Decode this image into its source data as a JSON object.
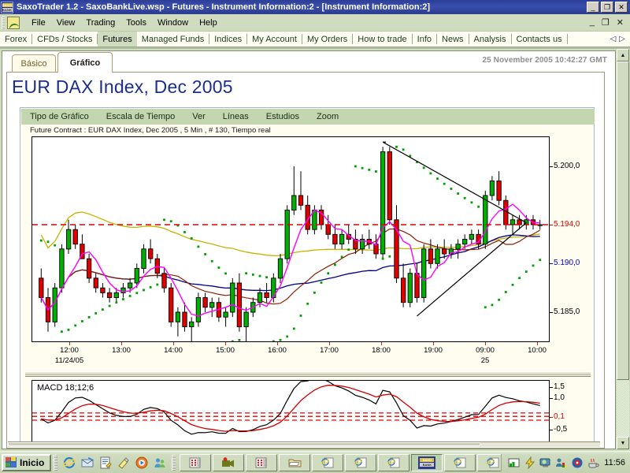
{
  "window": {
    "title": "SaxoTrader 1.2 - SaxoBankLive.wsp - Futures - Instrument Information:2 - [Instrument Information:2]",
    "logo_top": "SAXO",
    "logo_bottom": "BANK",
    "minimize": "_",
    "restore": "❐",
    "close": "✕"
  },
  "menubar": {
    "items": [
      "File",
      "View",
      "Trading",
      "Tools",
      "Window",
      "Help"
    ],
    "mdi_minimize": "_",
    "mdi_restore": "❐",
    "mdi_close": "✕"
  },
  "navstrip": {
    "items": [
      {
        "label": "Forex",
        "active": false
      },
      {
        "label": "CFDs / Stocks",
        "active": false
      },
      {
        "label": "Futures",
        "active": true
      },
      {
        "label": "Managed Funds",
        "active": false
      },
      {
        "label": "Indices",
        "active": false
      },
      {
        "label": "My Account",
        "active": false
      },
      {
        "label": "My Orders",
        "active": false
      },
      {
        "label": "How to trade",
        "active": false
      },
      {
        "label": "Info",
        "active": false
      },
      {
        "label": "News",
        "active": false
      },
      {
        "label": "Analysis",
        "active": false
      },
      {
        "label": "Contacts us",
        "active": false
      }
    ],
    "scroll_left": "◁",
    "scroll_right": "▷"
  },
  "document": {
    "tabs": [
      {
        "label": "Básico",
        "active": false
      },
      {
        "label": "Gráfico",
        "active": true
      }
    ],
    "timestamp": "25 November 2005 10:42:27 GMT",
    "title": "EUR DAX Index, Dec 2005"
  },
  "chart_toolbar": {
    "items": [
      "Tipo de Gráfico",
      "Escala de Tiempo",
      "Ver",
      "Líneas",
      "Estudios",
      "Zoom"
    ]
  },
  "chart_data": {
    "type": "line",
    "title": "Future Contract : EUR DAX Index, Dec 2005 , 5 Min , # 130, Tiempo real",
    "subtitle": "Future Contract : EUR DAX Index, Dec 2005 , 5 Min , # 130, Tiempo real",
    "instrument": "EUR DAX Index, Dec 2005",
    "interval": "5 Min",
    "bars": 130,
    "mode": "Tiempo real",
    "xlabel": "",
    "ylabel": "",
    "grid": false,
    "legend_position": "none",
    "ylim": [
      5182.0,
      5203.0
    ],
    "y_ticks": [
      {
        "value": 5200.0,
        "label": "5.200,0",
        "color": "#000000"
      },
      {
        "value": 5194.0,
        "label": "5.194,0",
        "color": "#e00000"
      },
      {
        "value": 5190.0,
        "label": "5.190,0",
        "color": "#0000cc"
      },
      {
        "value": 5185.0,
        "label": "5.185,0",
        "color": "#000000"
      }
    ],
    "x_ticks": [
      {
        "label": "12:00",
        "sub": "11/24/05"
      },
      {
        "label": "13:00",
        "sub": ""
      },
      {
        "label": "14:00",
        "sub": ""
      },
      {
        "label": "15:00",
        "sub": ""
      },
      {
        "label": "16:00",
        "sub": ""
      },
      {
        "label": "17:00",
        "sub": ""
      },
      {
        "label": "18:00",
        "sub": ""
      },
      {
        "label": "19:00",
        "sub": ""
      },
      {
        "label": "09:00",
        "sub": "25"
      },
      {
        "label": "10:00",
        "sub": ""
      }
    ],
    "last_price": 5194.0,
    "series": [
      {
        "name": "candlesticks",
        "type": "candlestick",
        "up_color": "#00b000",
        "down_color": "#e00000"
      },
      {
        "name": "MA long",
        "type": "line",
        "color": "#c8b400"
      },
      {
        "name": "MA mid",
        "type": "line",
        "color": "#00008b"
      },
      {
        "name": "MA short",
        "type": "line",
        "color": "#8b2000"
      },
      {
        "name": "MA fast",
        "type": "line",
        "color": "#ff00ff"
      },
      {
        "name": "Parabolic SAR",
        "type": "scatter",
        "color": "#00a000"
      },
      {
        "name": "Price level",
        "type": "hline",
        "color": "#e00000",
        "value": 5194.0
      },
      {
        "name": "Trendlines",
        "type": "line",
        "color": "#000000"
      }
    ],
    "ohlc": [
      [
        5188.5,
        5189.5,
        5186.0,
        5186.5
      ],
      [
        5186.5,
        5187.5,
        5183.0,
        5184.0
      ],
      [
        5184.0,
        5188.0,
        5183.5,
        5187.5
      ],
      [
        5187.5,
        5192.0,
        5187.0,
        5191.5
      ],
      [
        5191.5,
        5194.5,
        5191.0,
        5193.5
      ],
      [
        5193.5,
        5194.0,
        5191.5,
        5192.0
      ],
      [
        5192.0,
        5193.0,
        5190.5,
        5190.5
      ],
      [
        5190.5,
        5191.0,
        5188.0,
        5188.5
      ],
      [
        5188.5,
        5189.0,
        5187.0,
        5187.5
      ],
      [
        5187.5,
        5188.0,
        5186.5,
        5187.0
      ],
      [
        5187.0,
        5187.5,
        5186.0,
        5186.5
      ],
      [
        5186.5,
        5187.5,
        5186.0,
        5187.0
      ],
      [
        5187.0,
        5188.0,
        5186.5,
        5187.5
      ],
      [
        5187.5,
        5188.5,
        5187.0,
        5188.0
      ],
      [
        5188.0,
        5190.0,
        5187.5,
        5189.5
      ],
      [
        5189.5,
        5192.0,
        5189.0,
        5191.5
      ],
      [
        5191.5,
        5192.5,
        5190.0,
        5190.5
      ],
      [
        5190.5,
        5191.0,
        5188.5,
        5189.0
      ],
      [
        5189.0,
        5189.5,
        5187.0,
        5187.5
      ],
      [
        5187.5,
        5188.0,
        5183.5,
        5184.0
      ],
      [
        5184.0,
        5185.5,
        5182.5,
        5185.0
      ],
      [
        5185.0,
        5186.0,
        5183.0,
        5183.5
      ],
      [
        5183.5,
        5184.5,
        5182.0,
        5184.0
      ],
      [
        5184.0,
        5187.0,
        5183.5,
        5186.5
      ],
      [
        5186.5,
        5187.0,
        5185.0,
        5185.5
      ],
      [
        5185.5,
        5186.5,
        5184.5,
        5186.0
      ],
      [
        5186.0,
        5186.5,
        5184.0,
        5184.5
      ],
      [
        5184.5,
        5185.5,
        5183.5,
        5185.0
      ],
      [
        5185.0,
        5188.5,
        5184.5,
        5188.0
      ],
      [
        5188.0,
        5189.0,
        5183.0,
        5183.5
      ],
      [
        5183.5,
        5185.5,
        5182.0,
        5185.0
      ],
      [
        5185.0,
        5186.5,
        5184.5,
        5186.0
      ],
      [
        5186.0,
        5187.5,
        5185.5,
        5187.0
      ],
      [
        5187.0,
        5188.0,
        5186.0,
        5186.5
      ],
      [
        5186.5,
        5189.0,
        5186.0,
        5188.5
      ],
      [
        5188.5,
        5191.0,
        5188.0,
        5190.5
      ],
      [
        5190.5,
        5196.0,
        5190.0,
        5195.5
      ],
      [
        5195.5,
        5200.0,
        5195.0,
        5197.0
      ],
      [
        5197.0,
        5199.5,
        5195.5,
        5196.0
      ],
      [
        5196.0,
        5197.0,
        5193.0,
        5193.5
      ],
      [
        5193.5,
        5196.0,
        5193.0,
        5195.5
      ],
      [
        5195.5,
        5196.0,
        5193.5,
        5194.0
      ],
      [
        5194.0,
        5195.0,
        5192.5,
        5193.0
      ],
      [
        5193.0,
        5194.0,
        5191.5,
        5192.0
      ],
      [
        5192.0,
        5193.5,
        5191.5,
        5193.0
      ],
      [
        5193.0,
        5194.0,
        5192.0,
        5192.5
      ],
      [
        5192.5,
        5193.5,
        5191.0,
        5191.5
      ],
      [
        5191.5,
        5193.0,
        5191.0,
        5192.5
      ],
      [
        5192.5,
        5193.5,
        5191.5,
        5192.0
      ],
      [
        5192.0,
        5193.0,
        5190.5,
        5191.0
      ],
      [
        5191.0,
        5202.0,
        5190.5,
        5201.5
      ],
      [
        5201.5,
        5202.0,
        5194.0,
        5194.5
      ],
      [
        5194.5,
        5196.0,
        5188.0,
        5188.5
      ],
      [
        5188.5,
        5190.0,
        5185.5,
        5186.0
      ],
      [
        5186.0,
        5189.5,
        5185.5,
        5189.0
      ],
      [
        5189.0,
        5190.0,
        5186.0,
        5186.5
      ],
      [
        5186.5,
        5192.0,
        5186.0,
        5191.5
      ],
      [
        5191.5,
        5192.5,
        5189.5,
        5190.0
      ],
      [
        5190.0,
        5192.0,
        5189.5,
        5191.5
      ],
      [
        5191.5,
        5192.5,
        5190.5,
        5191.0
      ],
      [
        5191.0,
        5192.0,
        5190.5,
        5191.5
      ],
      [
        5191.5,
        5192.5,
        5190.5,
        5192.0
      ],
      [
        5192.0,
        5193.0,
        5191.5,
        5192.5
      ],
      [
        5192.5,
        5193.5,
        5192.0,
        5193.0
      ],
      [
        5193.0,
        5193.5,
        5191.5,
        5192.0
      ],
      [
        5192.0,
        5197.5,
        5191.5,
        5197.0
      ],
      [
        5197.0,
        5199.0,
        5196.5,
        5198.5
      ],
      [
        5198.5,
        5199.5,
        5196.0,
        5196.5
      ],
      [
        5196.5,
        5197.0,
        5193.5,
        5194.0
      ],
      [
        5194.0,
        5195.0,
        5193.0,
        5194.5
      ],
      [
        5194.5,
        5195.0,
        5193.5,
        5194.0
      ],
      [
        5194.0,
        5195.0,
        5193.5,
        5194.5
      ],
      [
        5194.5,
        5195.0,
        5193.5,
        5194.0
      ],
      [
        5194.0,
        5194.5,
        5193.5,
        5194.0
      ]
    ]
  },
  "macd": {
    "type": "line",
    "label": "MACD 18;12;6",
    "parameters": "18;12;6",
    "y_ticks": [
      {
        "value": 1.5,
        "label": "1,5",
        "color": "#000000"
      },
      {
        "value": 1.0,
        "label": "1,0",
        "color": "#000000"
      },
      {
        "value": 0.1,
        "label": "0,1",
        "color": "#e00000"
      },
      {
        "value": -0.5,
        "label": "-0,5",
        "color": "#000000"
      }
    ],
    "ylim": [
      -1.1,
      1.8
    ],
    "series": [
      {
        "name": "MACD",
        "color": "#000000"
      },
      {
        "name": "Signal",
        "color": "#d00000"
      },
      {
        "name": "Zero band",
        "color": "#e00000",
        "style": "dashed"
      }
    ]
  },
  "taskbar": {
    "start_label": "Inicio",
    "quick_launch": [
      "internet-explorer-icon",
      "outlook-express-icon",
      "notepad-icon",
      "paint-icon",
      "media-player-icon",
      "messenger-icon"
    ],
    "task_buttons": [
      "window-icon",
      "window-icon",
      "window-icon",
      "window-icon",
      "window-icon",
      "window-icon",
      "window-icon",
      "saxotrader-icon",
      "window-icon",
      "window-icon",
      "chat-icon"
    ],
    "tray_icons": [
      "network-icon",
      "power-icon",
      "display-icon",
      "users-icon",
      "antivirus-icon",
      "java-icon"
    ],
    "clock": "11:56"
  }
}
